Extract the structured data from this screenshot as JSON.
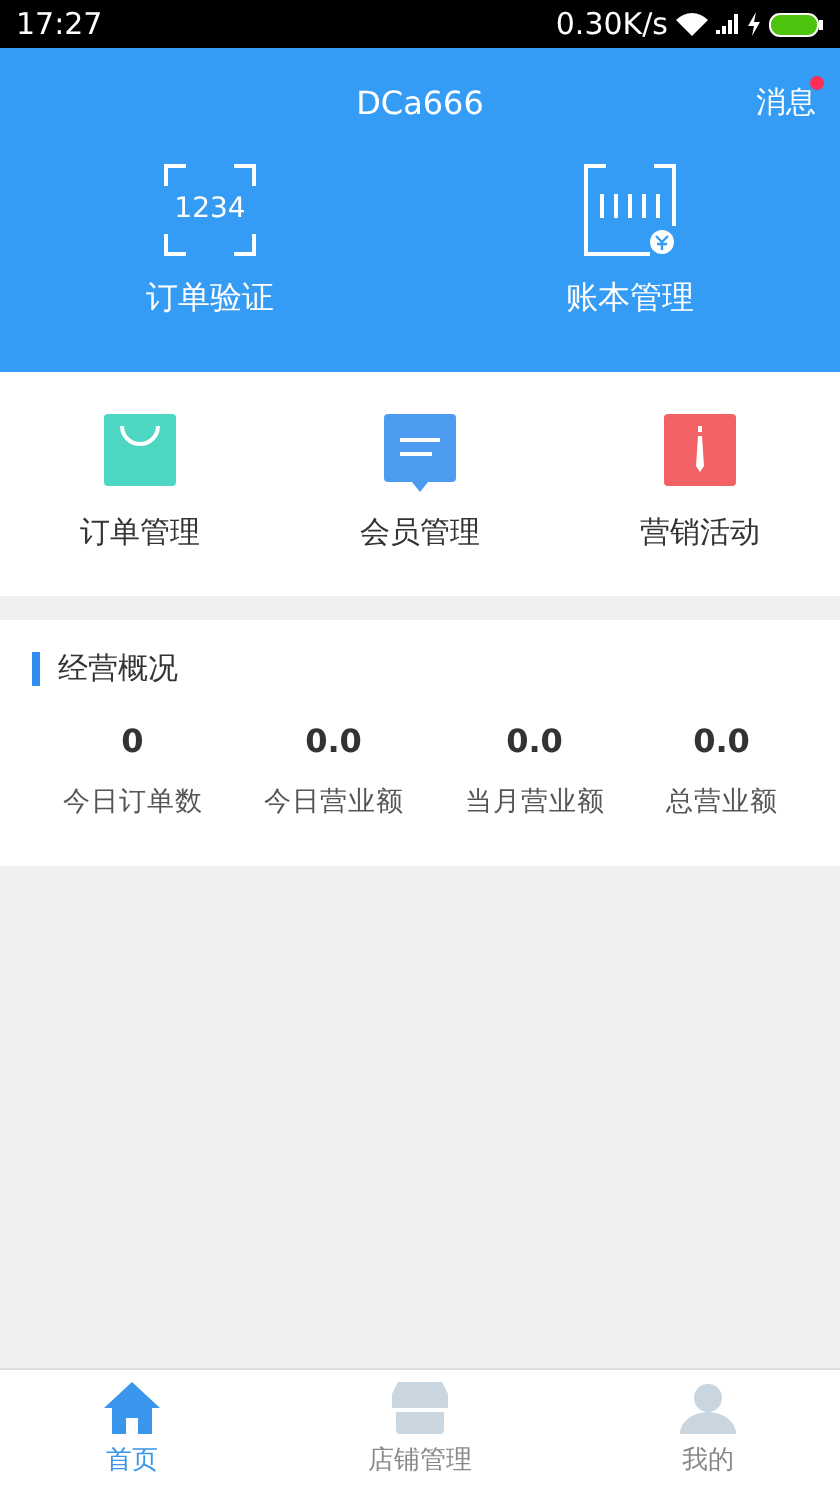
{
  "status_bar": {
    "time": "17:27",
    "speed": "0.30K/s"
  },
  "header": {
    "title": "DCa666",
    "messages": {
      "label": "消息",
      "unread": true
    }
  },
  "top_actions": [
    {
      "kind": "code",
      "icon_text": "1234",
      "label": "订单验证"
    },
    {
      "kind": "ledger",
      "label": "账本管理"
    }
  ],
  "menu": [
    {
      "kind": "bag",
      "label": "订单管理",
      "color": "#4dd6c1"
    },
    {
      "kind": "chat",
      "label": "会员管理",
      "color": "#4c9bf0"
    },
    {
      "kind": "tie",
      "label": "营销活动",
      "color": "#f26163"
    }
  ],
  "overview": {
    "title": "经营概况",
    "stats": [
      {
        "value": "0",
        "label": "今日订单数"
      },
      {
        "value": "0.0",
        "label": "今日营业额"
      },
      {
        "value": "0.0",
        "label": "当月营业额"
      },
      {
        "value": "0.0",
        "label": "总营业额"
      }
    ]
  },
  "tabs": [
    {
      "kind": "home",
      "label": "首页",
      "selected": true
    },
    {
      "kind": "shop",
      "label": "店铺管理",
      "selected": false
    },
    {
      "kind": "user",
      "label": "我的",
      "selected": false
    }
  ]
}
